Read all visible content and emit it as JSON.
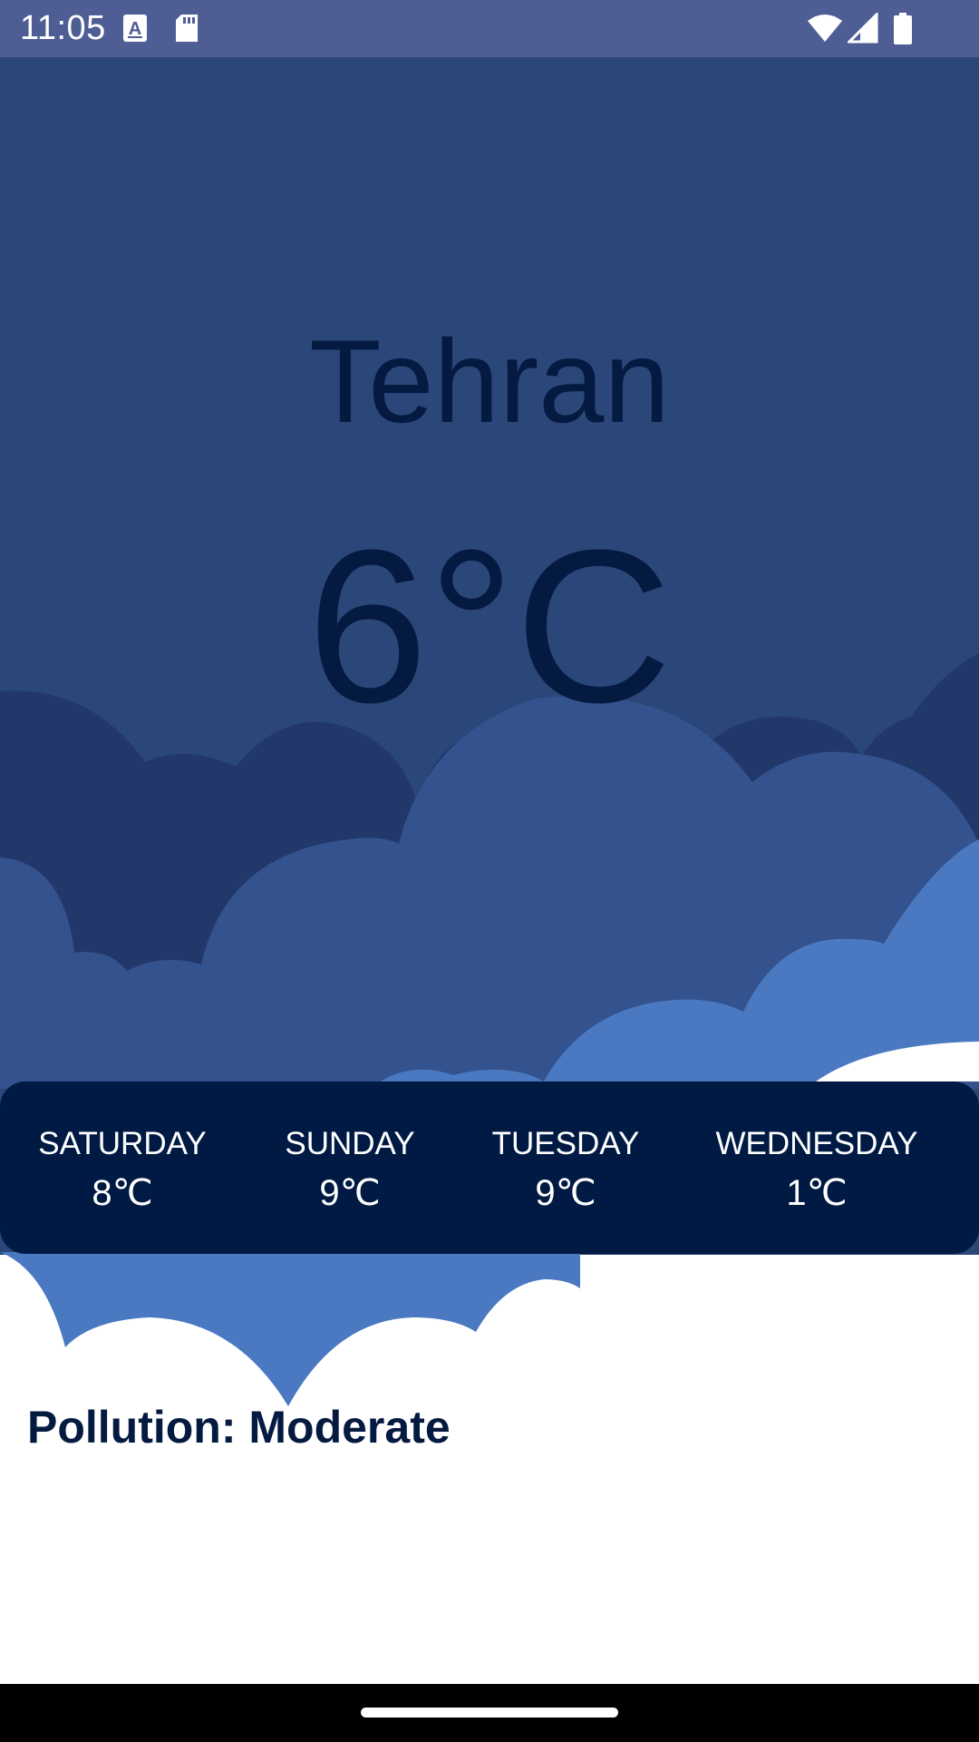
{
  "status_bar": {
    "time": "11:05",
    "left_icons": [
      "keyboard-a-icon",
      "sd-card-icon"
    ],
    "right_icons": [
      "wifi-icon",
      "cellular-signal-icon",
      "battery-icon"
    ]
  },
  "weather": {
    "city": "Tehran",
    "temperature": "6°C"
  },
  "forecast": [
    {
      "day": "SATURDAY",
      "temp": "8℃"
    },
    {
      "day": "SUNDAY",
      "temp": "9℃"
    },
    {
      "day": "TUESDAY",
      "temp": "9℃"
    },
    {
      "day": "WEDNESDAY",
      "temp": "1℃"
    }
  ],
  "pollution": {
    "label": "Pollution: Moderate"
  },
  "colors": {
    "status_bar": "#4e5e95",
    "sky": "#2b4679",
    "cloud_dark": "#22376a",
    "cloud_mid": "#34538e",
    "cloud_light": "#4a79c2",
    "card": "#001a44",
    "text_dark": "#051a40",
    "background": "#ffffff"
  }
}
